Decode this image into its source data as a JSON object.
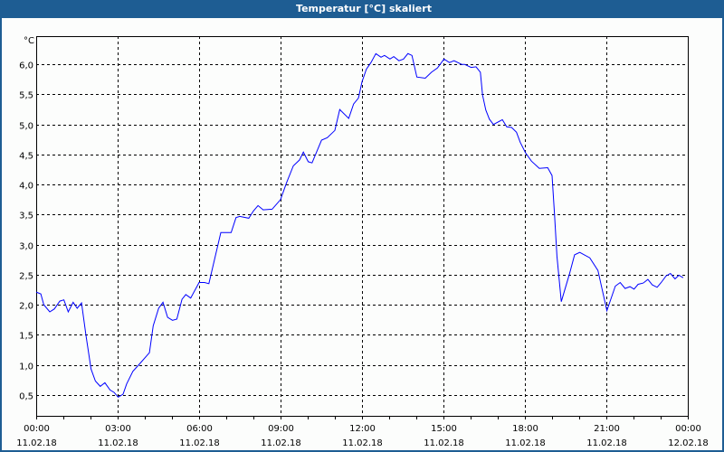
{
  "window": {
    "title": "Temperatur [°C] skaliert"
  },
  "chart_data": {
    "type": "line",
    "title": "Temperatur [°C] skaliert",
    "ylabel": "°C",
    "xlabel": "",
    "ylim": [
      0.15,
      6.47
    ],
    "xlim": [
      0,
      24
    ],
    "grid": true,
    "y_ticks": [
      {
        "v": 0.5,
        "label": "0,5"
      },
      {
        "v": 1.0,
        "label": "1,0"
      },
      {
        "v": 1.5,
        "label": "1,5"
      },
      {
        "v": 2.0,
        "label": "2,0"
      },
      {
        "v": 2.5,
        "label": "2,5"
      },
      {
        "v": 3.0,
        "label": "3,0"
      },
      {
        "v": 3.5,
        "label": "3,5"
      },
      {
        "v": 4.0,
        "label": "4,0"
      },
      {
        "v": 4.5,
        "label": "4,5"
      },
      {
        "v": 5.0,
        "label": "5,0"
      },
      {
        "v": 5.5,
        "label": "5,5"
      },
      {
        "v": 6.0,
        "label": "6,0"
      }
    ],
    "x_ticks": [
      {
        "h": 0,
        "time": "00:00",
        "date": "11.02.18"
      },
      {
        "h": 3,
        "time": "03:00",
        "date": "11.02.18"
      },
      {
        "h": 6,
        "time": "06:00",
        "date": "11.02.18"
      },
      {
        "h": 9,
        "time": "09:00",
        "date": "11.02.18"
      },
      {
        "h": 12,
        "time": "12:00",
        "date": "11.02.18"
      },
      {
        "h": 15,
        "time": "15:00",
        "date": "11.02.18"
      },
      {
        "h": 18,
        "time": "18:00",
        "date": "11.02.18"
      },
      {
        "h": 21,
        "time": "21:00",
        "date": "11.02.18"
      },
      {
        "h": 24,
        "time": "00:00",
        "date": "12.02.18"
      }
    ],
    "series": [
      {
        "name": "Temperatur",
        "color": "#0000ff",
        "x": [
          0,
          0.17,
          0.28,
          0.5,
          0.67,
          0.87,
          1.02,
          1.18,
          1.36,
          1.51,
          1.67,
          1.83,
          2.02,
          2.18,
          2.36,
          2.53,
          2.72,
          2.87,
          3.02,
          3.2,
          3.33,
          3.56,
          3.78,
          4.17,
          4.31,
          4.51,
          4.67,
          4.84,
          5.02,
          5.18,
          5.37,
          5.51,
          5.69,
          6.0,
          6.2,
          6.36,
          6.8,
          7.18,
          7.36,
          7.5,
          7.83,
          8.0,
          8.17,
          8.36,
          8.69,
          9.0,
          9.22,
          9.47,
          9.7,
          9.84,
          10.02,
          10.16,
          10.51,
          10.72,
          11.0,
          11.18,
          11.51,
          11.69,
          11.87,
          12.0,
          12.16,
          12.33,
          12.51,
          12.7,
          12.83,
          13.03,
          13.17,
          13.36,
          13.53,
          13.69,
          13.84,
          14.02,
          14.33,
          14.56,
          14.78,
          15.02,
          15.22,
          15.39,
          15.67,
          15.78,
          16.02,
          16.2,
          16.36,
          16.44,
          16.56,
          16.69,
          16.84,
          17.17,
          17.33,
          17.51,
          17.69,
          17.83,
          18.02,
          18.24,
          18.53,
          18.84,
          19.0,
          19.09,
          19.18,
          19.34,
          19.64,
          19.83,
          20.02,
          20.39,
          20.69,
          21.02,
          21.33,
          21.51,
          21.69,
          21.87,
          22.02,
          22.17,
          22.36,
          22.53,
          22.69,
          22.87,
          23.02,
          23.2,
          23.36,
          23.53,
          23.67,
          23.83
        ],
        "y": [
          2.21,
          2.18,
          2.0,
          1.88,
          1.93,
          2.06,
          2.08,
          1.88,
          2.04,
          1.94,
          2.03,
          1.5,
          0.93,
          0.73,
          0.64,
          0.7,
          0.58,
          0.54,
          0.46,
          0.51,
          0.68,
          0.89,
          1.0,
          1.2,
          1.65,
          1.94,
          2.04,
          1.79,
          1.74,
          1.76,
          2.09,
          2.17,
          2.11,
          2.37,
          2.37,
          2.35,
          3.2,
          3.2,
          3.45,
          3.47,
          3.44,
          3.56,
          3.65,
          3.58,
          3.59,
          3.75,
          4.03,
          4.31,
          4.41,
          4.54,
          4.38,
          4.36,
          4.74,
          4.78,
          4.9,
          5.25,
          5.1,
          5.34,
          5.44,
          5.71,
          5.92,
          6.03,
          6.18,
          6.12,
          6.15,
          6.09,
          6.13,
          6.06,
          6.09,
          6.18,
          6.15,
          5.79,
          5.77,
          5.87,
          5.94,
          6.09,
          6.03,
          6.06,
          6.0,
          6.0,
          5.95,
          5.96,
          5.87,
          5.49,
          5.24,
          5.09,
          5.0,
          5.08,
          4.96,
          4.95,
          4.87,
          4.7,
          4.53,
          4.39,
          4.27,
          4.28,
          4.15,
          3.51,
          2.81,
          2.05,
          2.51,
          2.83,
          2.87,
          2.78,
          2.57,
          1.9,
          2.31,
          2.37,
          2.27,
          2.3,
          2.26,
          2.34,
          2.36,
          2.42,
          2.33,
          2.29,
          2.37,
          2.48,
          2.52,
          2.43,
          2.49,
          2.45
        ]
      }
    ]
  }
}
